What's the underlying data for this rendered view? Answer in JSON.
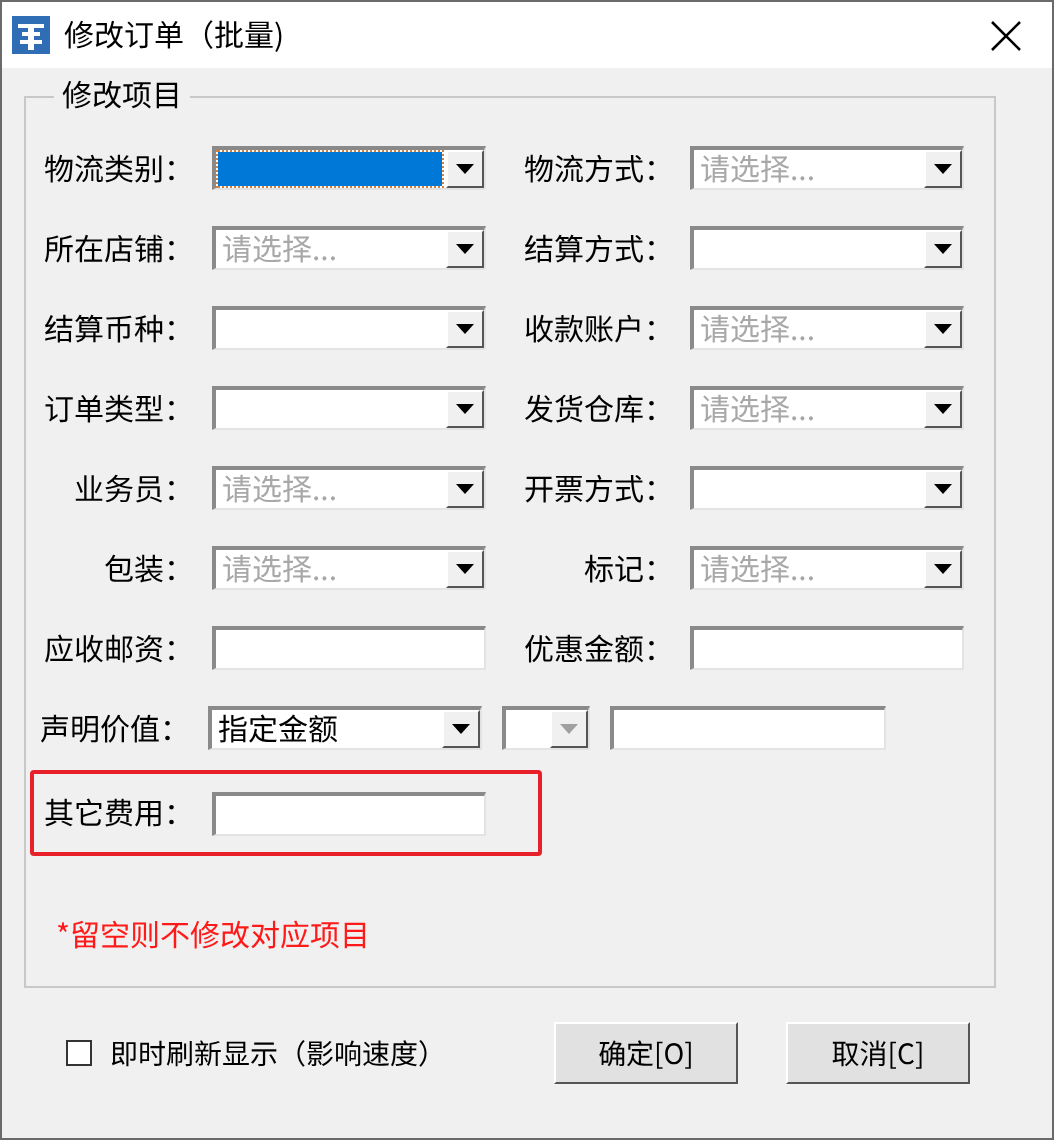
{
  "window": {
    "title": "修改订单（批量)"
  },
  "group": {
    "title": "修改项目",
    "rows": [
      {
        "highlighted": false,
        "items": [
          {
            "label": "物流类别：",
            "controls": [
              {
                "kind": "combo",
                "focused": true,
                "disabled": false
              }
            ]
          },
          {
            "label": "物流方式：",
            "controls": [
              {
                "kind": "combo",
                "placeholder": "请选择...",
                "focused": false,
                "disabled": false
              }
            ]
          }
        ]
      },
      {
        "highlighted": false,
        "items": [
          {
            "label": "所在店铺：",
            "controls": [
              {
                "kind": "combo",
                "placeholder": "请选择...",
                "focused": false,
                "disabled": false
              }
            ]
          },
          {
            "label": "结算方式：",
            "controls": [
              {
                "kind": "combo",
                "focused": false,
                "disabled": false
              }
            ]
          }
        ]
      },
      {
        "highlighted": false,
        "items": [
          {
            "label": "结算币种：",
            "controls": [
              {
                "kind": "combo",
                "focused": false,
                "disabled": false
              }
            ]
          },
          {
            "label": "收款账户：",
            "controls": [
              {
                "kind": "combo",
                "placeholder": "请选择...",
                "focused": false,
                "disabled": false
              }
            ]
          }
        ]
      },
      {
        "highlighted": false,
        "items": [
          {
            "label": "订单类型：",
            "controls": [
              {
                "kind": "combo",
                "focused": false,
                "disabled": false
              }
            ]
          },
          {
            "label": "发货仓库：",
            "controls": [
              {
                "kind": "combo",
                "placeholder": "请选择...",
                "focused": false,
                "disabled": false
              }
            ]
          }
        ]
      },
      {
        "highlighted": false,
        "items": [
          {
            "label": "业务员：",
            "controls": [
              {
                "kind": "combo",
                "placeholder": "请选择...",
                "focused": false,
                "disabled": false
              }
            ]
          },
          {
            "label": "开票方式：",
            "controls": [
              {
                "kind": "combo",
                "focused": false,
                "disabled": false
              }
            ]
          }
        ]
      },
      {
        "highlighted": false,
        "items": [
          {
            "label": "包装：",
            "controls": [
              {
                "kind": "combo",
                "placeholder": "请选择...",
                "focused": false,
                "disabled": false
              }
            ]
          },
          {
            "label": "标记：",
            "controls": [
              {
                "kind": "combo",
                "placeholder": "请选择...",
                "focused": false,
                "disabled": false
              }
            ]
          }
        ]
      },
      {
        "highlighted": false,
        "items": [
          {
            "label": "应收邮资：",
            "controls": [
              {
                "kind": "text"
              }
            ]
          },
          {
            "label": "优惠金额：",
            "controls": [
              {
                "kind": "text"
              }
            ]
          }
        ]
      },
      {
        "highlighted": false,
        "items": [
          {
            "label": "声明价值：",
            "controls": [
              {
                "kind": "combo",
                "value": "指定金额",
                "focused": false,
                "disabled": false
              },
              {
                "kind": "mini-combo",
                "focused": false,
                "disabled": true
              },
              {
                "kind": "text"
              }
            ]
          }
        ]
      },
      {
        "highlighted": true,
        "items": [
          {
            "label": "其它费用：",
            "controls": [
              {
                "kind": "text"
              }
            ]
          }
        ]
      }
    ],
    "note": "*留空则不修改对应项目"
  },
  "options": [
    {
      "label": "即时刷新显示（影响速度）",
      "checked": false
    }
  ],
  "buttons": [
    "确定[O]",
    "取消[C]"
  ]
}
